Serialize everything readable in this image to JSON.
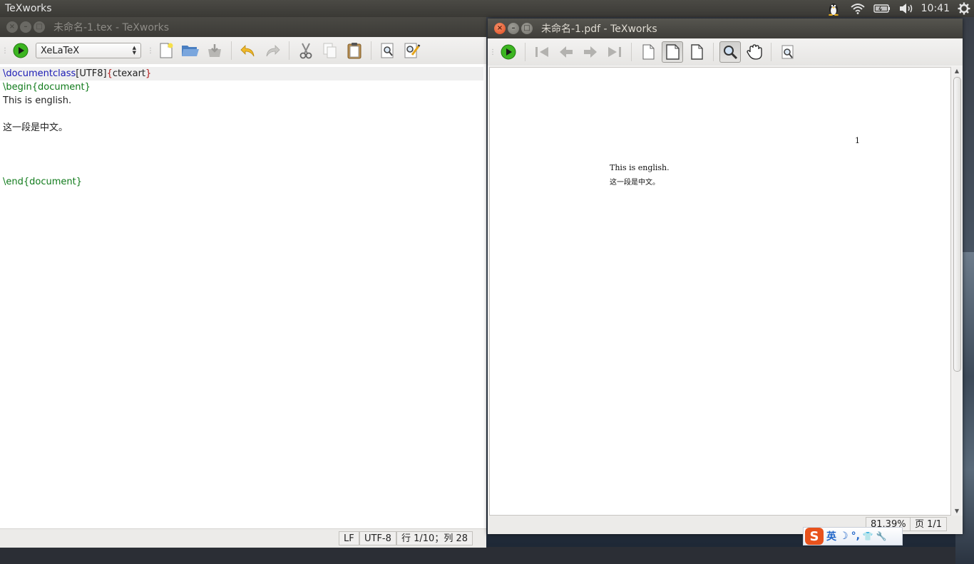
{
  "top_panel": {
    "app_name": "TeXworks",
    "clock": "10:41",
    "tray_icons": [
      "penguin-icon",
      "wifi-icon",
      "battery-icon",
      "volume-icon",
      "power-gear-icon"
    ]
  },
  "editor_window": {
    "title": "未命名-1.tex - TeXworks",
    "typeset_engine": "XeLaTeX",
    "toolbar_icons": [
      "typeset-play-icon",
      "new-document-icon",
      "open-folder-icon",
      "save-icon",
      "undo-icon",
      "redo-icon",
      "cut-icon",
      "copy-icon",
      "paste-icon",
      "find-icon",
      "replace-icon"
    ],
    "code": {
      "line1": {
        "cmd": "\\documentclass",
        "opt": "[UTF8]",
        "brace_open": "{",
        "arg": "ctexart",
        "brace_close": "}"
      },
      "line2": "\\begin{document}",
      "line3": "This is english.",
      "line4": "",
      "line5": "这一段是中文。",
      "line6": "",
      "line7": "",
      "line8": "",
      "line9": "\\end{document}"
    },
    "status": {
      "line_ending": "LF",
      "encoding": "UTF-8",
      "position": "行 1/10；列 28"
    }
  },
  "pdf_window": {
    "title": "未命名-1.pdf - TeXworks",
    "toolbar_icons": [
      "typeset-play-icon",
      "first-page-icon",
      "previous-page-icon",
      "next-page-icon",
      "last-page-icon",
      "actual-size-icon",
      "fit-width-icon",
      "fit-window-icon",
      "magnify-icon",
      "hand-scroll-icon",
      "find-icon"
    ],
    "page": {
      "page_number": "1",
      "line1": "This is english.",
      "line2": "这一段是中文。"
    },
    "status": {
      "zoom": "81.39%",
      "page": "页 1/1"
    }
  },
  "ime": {
    "logo": "S",
    "mode": "英",
    "items": [
      "☽",
      "°,",
      "👕",
      "🔧"
    ]
  },
  "colors": {
    "keyword_blue": "#1a1ab5",
    "keyword_green": "#0f7a1a",
    "brace_red": "#b01515",
    "run_button_green": "#3cb521",
    "close_button_orange": "#df4b1e"
  }
}
